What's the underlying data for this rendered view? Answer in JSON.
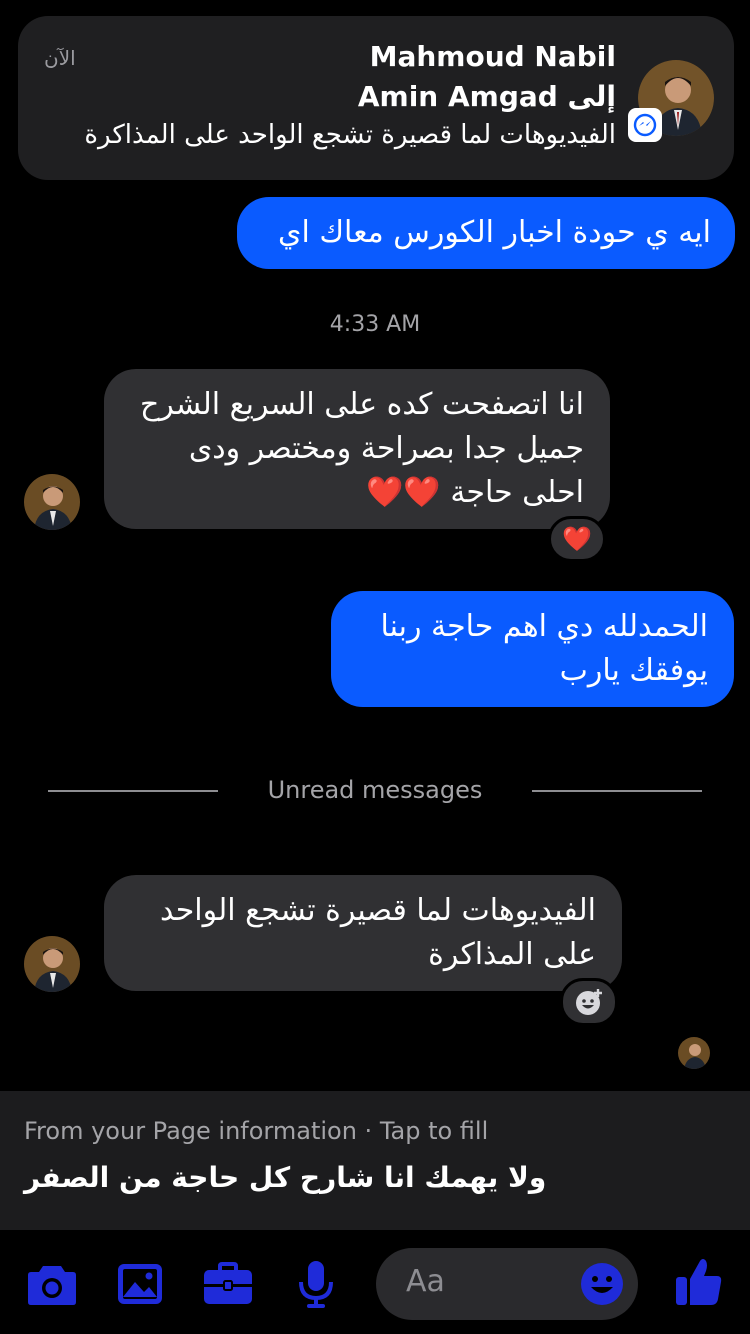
{
  "notification": {
    "time": "الآن",
    "sender": "Mahmoud Nabil",
    "recipient": "إلى Amin Amgad",
    "body": "الفيديوهات لما قصيرة تشجع الواحد على المذاكرة"
  },
  "messages": [
    {
      "direction": "outgoing",
      "lines": [
        "ايه ي حودة اخبار الكورس معاك اي"
      ]
    },
    {
      "direction": "incoming",
      "lines": [
        "انا اتصفحت كده على السريع الشرح",
        "جميل جدا بصراحة ومختصر  ودى",
        "احلى حاجة ❤️❤️"
      ],
      "reaction": "❤️"
    },
    {
      "direction": "outgoing",
      "lines": [
        "الحمدلله دي اهم حاجة ربنا",
        "يوفقك يارب"
      ]
    },
    {
      "direction": "incoming",
      "lines": [
        "الفيديوهات لما قصيرة تشجع الواحد",
        "على المذاكرة"
      ]
    }
  ],
  "timestamp": "4:33 AM",
  "unread_divider": "Unread messages",
  "suggestion": {
    "label": "From your Page information · Tap to fill",
    "text": "ولا يهمك انا شارح كل حاجة من الصفر"
  },
  "composer": {
    "placeholder": "Aa",
    "tools": [
      "camera-icon",
      "gallery-icon",
      "briefcase-icon",
      "microphone-icon",
      "emoji-icon",
      "like-icon"
    ]
  },
  "colors": {
    "accent": "#0a5bff",
    "icon_blue": "#1f2bd9",
    "incoming_bubble": "#303033",
    "background": "#000000"
  }
}
